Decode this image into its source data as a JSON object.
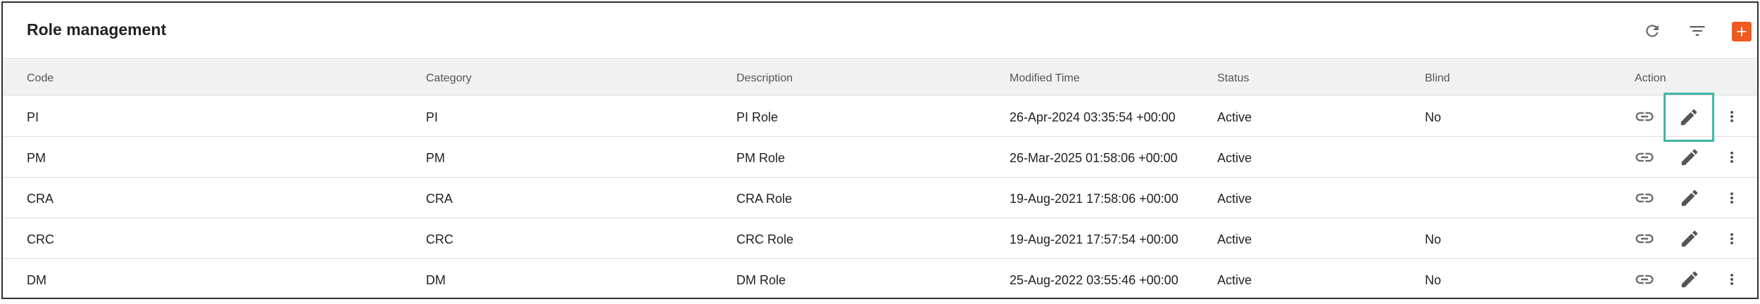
{
  "header": {
    "title": "Role management",
    "refresh_icon": "refresh-icon",
    "filter_icon": "filter-icon",
    "add_icon": "add-icon",
    "add_color": "#f05a1e"
  },
  "columns": {
    "code": "Code",
    "category": "Category",
    "description": "Description",
    "modified": "Modified Time",
    "status": "Status",
    "blind": "Blind",
    "action": "Action"
  },
  "rows": [
    {
      "code": "PI",
      "category": "PI",
      "description": "PI Role",
      "modified": "26-Apr-2024 03:35:54 +00:00",
      "status": "Active",
      "blind": "No"
    },
    {
      "code": "PM",
      "category": "PM",
      "description": "PM Role",
      "modified": "26-Mar-2025 01:58:06 +00:00",
      "status": "Active",
      "blind": ""
    },
    {
      "code": "CRA",
      "category": "CRA",
      "description": "CRA Role",
      "modified": "19-Aug-2021 17:58:06 +00:00",
      "status": "Active",
      "blind": ""
    },
    {
      "code": "CRC",
      "category": "CRC",
      "description": "CRC Role",
      "modified": "19-Aug-2021 17:57:54 +00:00",
      "status": "Active",
      "blind": "No"
    },
    {
      "code": "DM",
      "category": "DM",
      "description": "DM Role",
      "modified": "25-Aug-2022 03:55:46 +00:00",
      "status": "Active",
      "blind": "No"
    }
  ],
  "row_actions": [
    "link-icon",
    "edit-icon",
    "more-vert-icon"
  ],
  "highlight_color": "#3fb5a5"
}
